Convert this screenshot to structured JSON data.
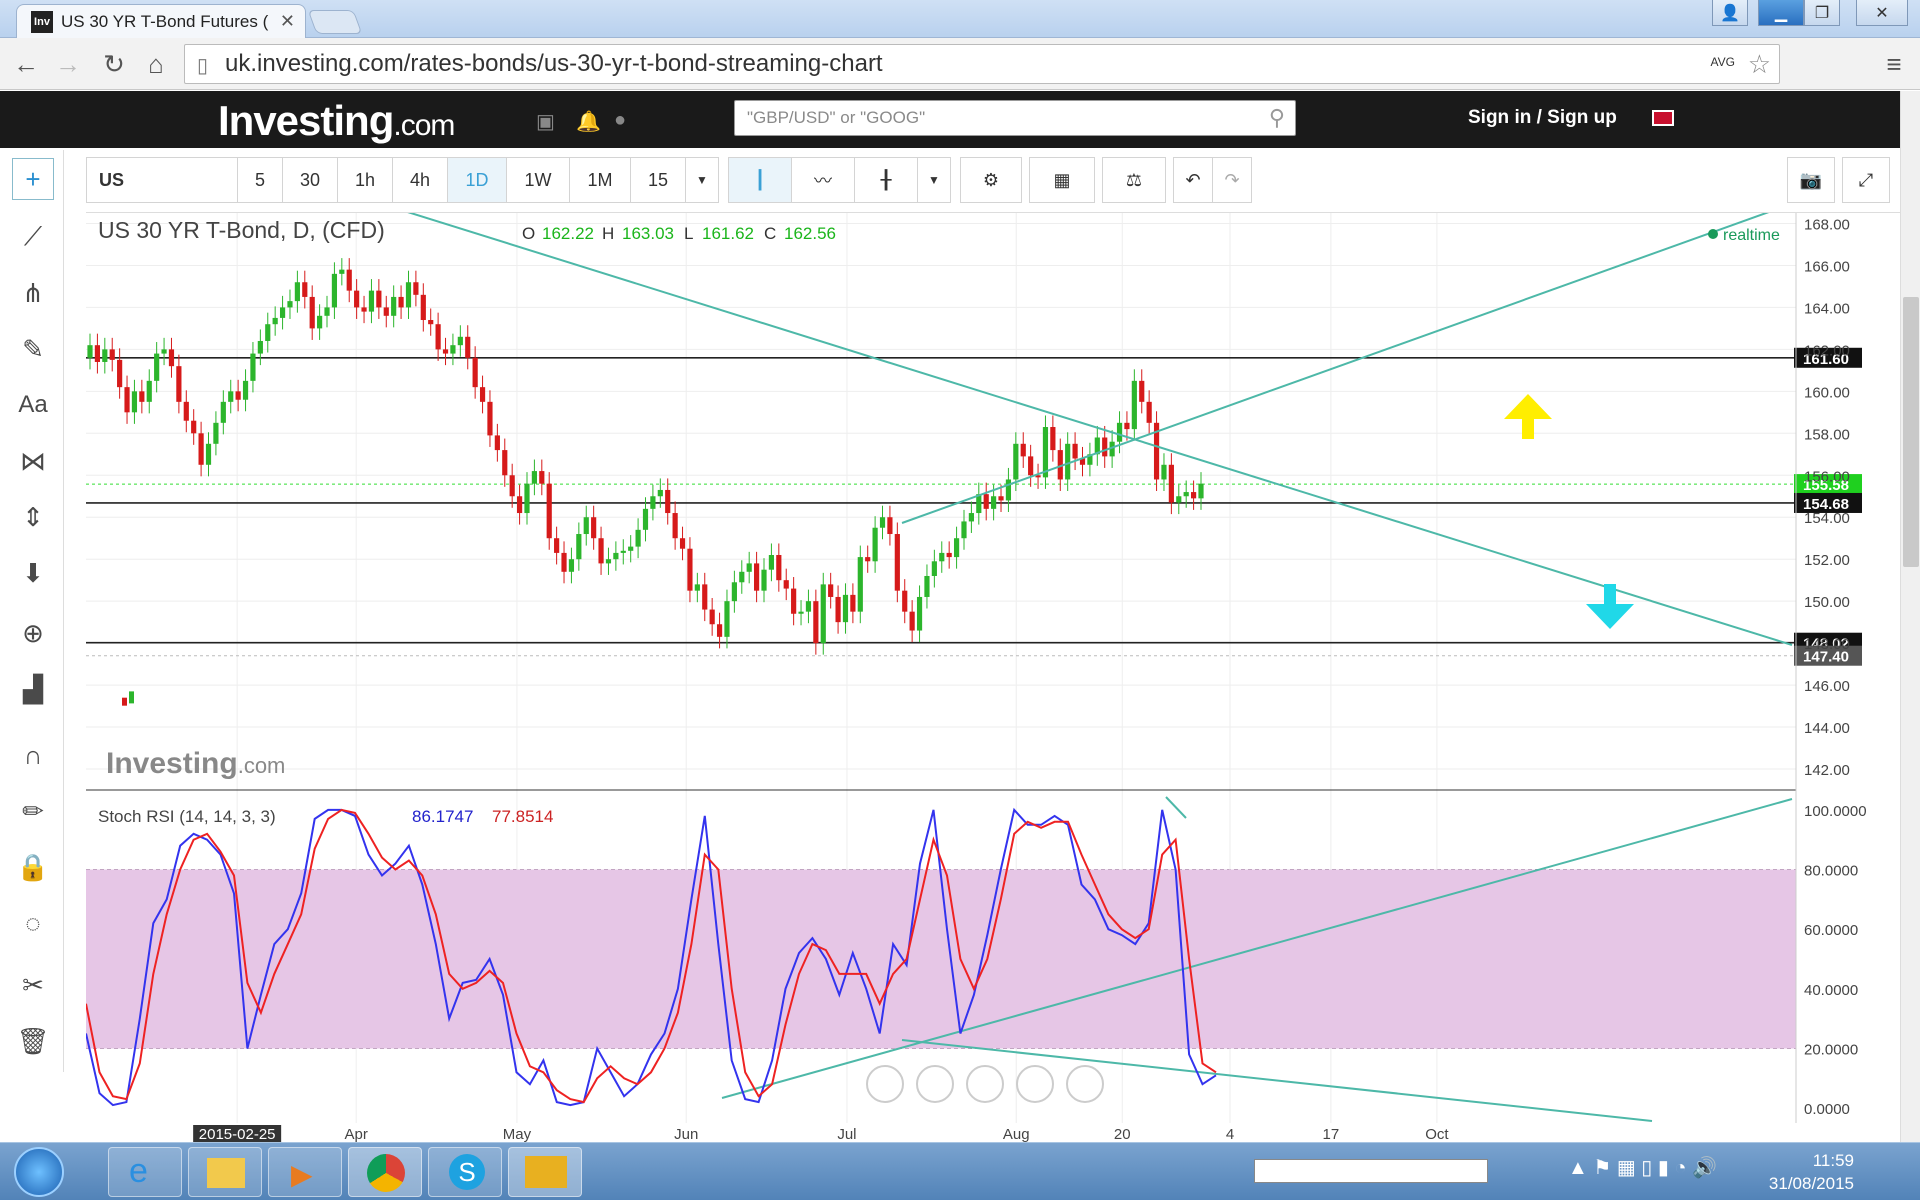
{
  "browser": {
    "tab_title": "US 30 YR T-Bond Futures (",
    "favicon": "Inv",
    "url": "uk.investing.com/rates-bonds/us-30-yr-t-bond-streaming-chart"
  },
  "site": {
    "logo_main": "Investing",
    "logo_suffix": ".com",
    "search_placeholder": "\"GBP/USD\" or \"GOOG\"",
    "signin": "Sign in / Sign up"
  },
  "toolbar": {
    "symbol": "US",
    "intervals": [
      "5",
      "30",
      "1h",
      "4h",
      "1D",
      "1W",
      "1M",
      "15"
    ],
    "selected_interval": "1D"
  },
  "chart_header": {
    "title": "US 30 YR T-Bond, D, (CFD)",
    "o_label": "O",
    "o": "162.22",
    "h_label": "H",
    "h": "163.03",
    "l_label": "L",
    "l": "161.62",
    "c_label": "C",
    "c": "162.56",
    "realtime": "realtime"
  },
  "watermark": {
    "main": "Investing",
    "suffix": ".com"
  },
  "indicator": {
    "title": "Stoch RSI (14, 14, 3, 3)",
    "k": "86.1747",
    "d": "77.8514"
  },
  "chart_data": [
    {
      "type": "candlestick",
      "title": "US 30 YR T-Bond, D, (CFD)",
      "y_ticks": [
        "168.00",
        "166.00",
        "164.00",
        "162.00",
        "160.00",
        "158.00",
        "156.00",
        "154.00",
        "152.00",
        "150.00",
        "148.00",
        "146.00",
        "144.00",
        "142.00"
      ],
      "ylim": [
        141,
        168.5
      ],
      "x_ticks": [
        "2015-02-25",
        "Apr",
        "May",
        "Jun",
        "Jul",
        "Aug",
        "20",
        "4",
        "17",
        "Oct"
      ],
      "horizontal_levels": [
        {
          "value": 161.6,
          "label": "161.60"
        },
        {
          "value": 155.58,
          "label": "155.58"
        },
        {
          "value": 154.68,
          "label": "154.68"
        },
        {
          "value": 148.02,
          "label": "148.02"
        },
        {
          "value": 147.4,
          "label": "147.40"
        }
      ],
      "close_series": [
        162.2,
        161.4,
        162.0,
        161.5,
        160.2,
        159.0,
        160.0,
        159.5,
        160.5,
        161.8,
        162.0,
        161.2,
        159.5,
        158.6,
        158.0,
        156.5,
        157.5,
        158.5,
        159.5,
        160.0,
        159.6,
        160.5,
        161.8,
        162.4,
        163.2,
        163.5,
        164.0,
        164.3,
        165.2,
        164.5,
        163.0,
        163.6,
        164.0,
        165.6,
        165.8,
        164.8,
        164.0,
        163.8,
        164.8,
        164.0,
        163.6,
        164.5,
        164.0,
        165.2,
        164.6,
        163.4,
        163.2,
        162.0,
        161.8,
        162.2,
        162.6,
        161.6,
        160.2,
        159.5,
        157.9,
        157.2,
        156.0,
        155.0,
        154.2,
        155.6,
        156.2,
        155.6,
        153.0,
        152.3,
        151.4,
        152.0,
        153.2,
        154.0,
        153.0,
        151.8,
        152.0,
        152.3,
        152.4,
        152.6,
        153.4,
        154.4,
        155.0,
        155.3,
        154.2,
        153.0,
        152.5,
        150.5,
        150.8,
        149.6,
        148.9,
        148.3,
        150.0,
        150.9,
        151.4,
        151.8,
        150.5,
        151.5,
        152.2,
        151.0,
        150.6,
        149.4,
        149.5,
        150.0,
        148.0,
        150.8,
        150.2,
        149.0,
        150.3,
        149.5,
        152.1,
        151.9,
        153.5,
        154.0,
        153.2,
        150.5,
        149.5,
        148.6,
        150.2,
        151.2,
        151.9,
        152.3,
        152.1,
        153.0,
        153.8,
        154.2,
        155.1,
        154.4,
        155.0,
        154.8,
        155.8,
        157.5,
        156.9,
        156.0,
        155.9,
        158.3,
        157.2,
        155.8,
        157.5,
        156.8,
        156.5,
        157.0,
        157.8,
        156.9,
        157.6,
        158.5,
        158.2,
        160.5,
        159.5,
        158.5,
        155.8,
        156.5,
        154.7,
        155.0,
        155.2,
        154.9,
        155.6
      ]
    },
    {
      "type": "line",
      "title": "Stoch RSI (14, 14, 3, 3)",
      "y_ticks": [
        "100.0000",
        "80.0000",
        "60.0000",
        "40.0000",
        "20.0000",
        "0.0000"
      ],
      "ylim": [
        -5,
        105
      ],
      "series": [
        {
          "name": "%K",
          "values": [
            25,
            5,
            1,
            2,
            30,
            62,
            70,
            88,
            92,
            90,
            85,
            72,
            20,
            38,
            55,
            60,
            72,
            97,
            100,
            100,
            98,
            85,
            78,
            82,
            88,
            75,
            55,
            30,
            42,
            43,
            50,
            38,
            12,
            8,
            16,
            2,
            1,
            2,
            20,
            12,
            4,
            8,
            18,
            25,
            40,
            70,
            98,
            55,
            16,
            3,
            2,
            16,
            40,
            52,
            57,
            50,
            38,
            52,
            40,
            25,
            55,
            48,
            82,
            100,
            60,
            25,
            38,
            58,
            80,
            100,
            95,
            95,
            98,
            95,
            75,
            70,
            60,
            58,
            55,
            62,
            100,
            80,
            18,
            8,
            11
          ]
        },
        {
          "name": "%D",
          "values": [
            35,
            12,
            4,
            3,
            15,
            45,
            65,
            80,
            90,
            92,
            86,
            78,
            42,
            32,
            45,
            55,
            65,
            87,
            97,
            100,
            99,
            92,
            84,
            80,
            83,
            78,
            65,
            45,
            40,
            42,
            46,
            42,
            25,
            14,
            12,
            6,
            3,
            2,
            10,
            14,
            10,
            8,
            12,
            20,
            32,
            55,
            85,
            80,
            40,
            12,
            4,
            8,
            28,
            45,
            55,
            53,
            45,
            45,
            45,
            35,
            45,
            50,
            70,
            90,
            78,
            50,
            40,
            50,
            70,
            92,
            96,
            94,
            96,
            96,
            85,
            75,
            65,
            60,
            57,
            60,
            85,
            90,
            50,
            15,
            12
          ]
        }
      ],
      "bands": [
        20,
        80
      ]
    }
  ],
  "taskbar": {
    "time": "11:59",
    "date": "31/08/2015"
  },
  "colors": {
    "up": "#2cb52c",
    "down": "#d61a1a",
    "k_line": "#3333ee",
    "d_line": "#ee2222",
    "trend": "#4db8a8",
    "band": "#e6c6e6",
    "price_tag": "#1fd01f"
  }
}
